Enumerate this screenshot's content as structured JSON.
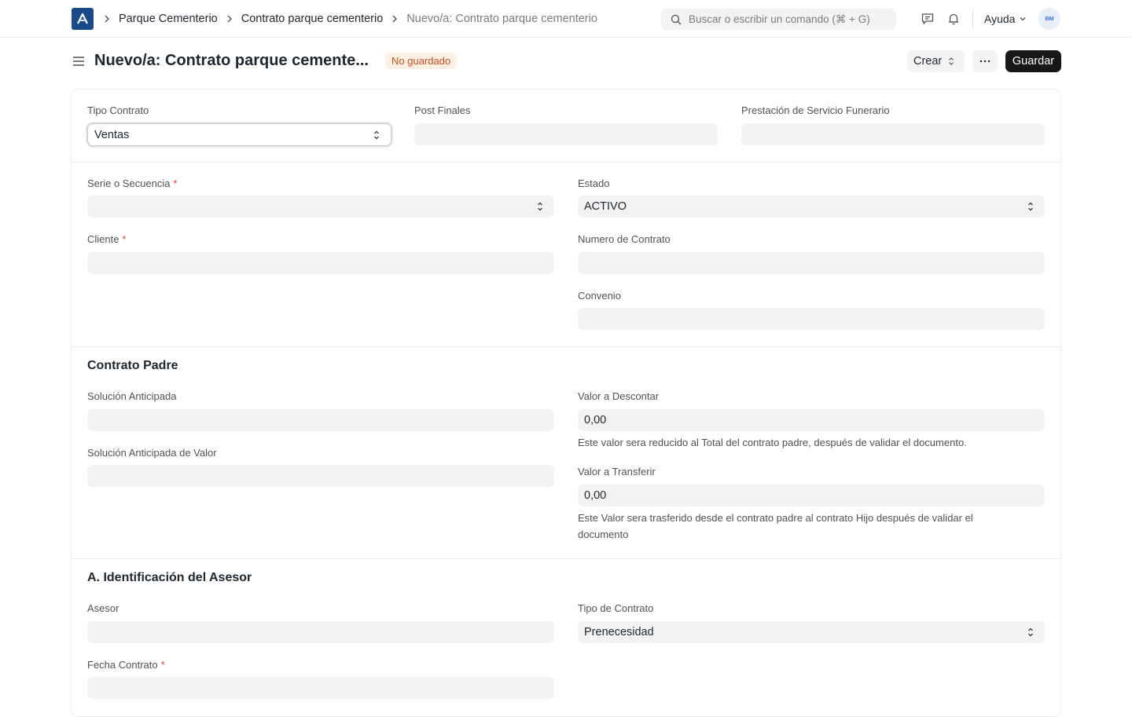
{
  "navbar": {
    "breadcrumbs": [
      "Parque Cementerio",
      "Contrato parque cementerio",
      "Nuevo/a: Contrato parque cementerio"
    ],
    "search_placeholder": "Buscar o escribir un comando (⌘ + G)",
    "help_label": "Ayuda",
    "avatar_initials": "BM"
  },
  "page": {
    "title": "Nuevo/a: Contrato parque cemente...",
    "status_badge": "No guardado",
    "create_label": "Crear",
    "more_label": "···",
    "save_label": "Guardar"
  },
  "form": {
    "tipo_contrato": {
      "label": "Tipo Contrato",
      "value": "Ventas"
    },
    "post_finales": {
      "label": "Post Finales",
      "value": ""
    },
    "prestacion": {
      "label": "Prestación de Servicio Funerario",
      "value": ""
    },
    "serie": {
      "label": "Serie o Secuencia",
      "required": "*",
      "value": ""
    },
    "estado": {
      "label": "Estado",
      "value": "ACTIVO"
    },
    "cliente": {
      "label": "Cliente",
      "required": "*",
      "value": ""
    },
    "numero_contrato": {
      "label": "Numero de Contrato",
      "value": ""
    },
    "convenio": {
      "label": "Convenio",
      "value": ""
    },
    "contrato_padre": {
      "title": "Contrato Padre",
      "solucion_anticipada": {
        "label": "Solución Anticipada",
        "value": ""
      },
      "solucion_anticipada_valor": {
        "label": "Solución Anticipada de Valor",
        "value": ""
      },
      "valor_descontar": {
        "label": "Valor a Descontar",
        "value": "0,00",
        "help": "Este valor sera reducido al Total del contrato padre, después de validar el documento."
      },
      "valor_transferir": {
        "label": "Valor a Transferir",
        "value": "0,00",
        "help_line1": "Este Valor sera trasferido desde el contrato padre al contrato Hijo después de validar el",
        "help_line2": "documento"
      }
    },
    "asesor_section": {
      "title": "A. Identificación del Asesor",
      "asesor": {
        "label": "Asesor",
        "value": ""
      },
      "tipo_de_contrato": {
        "label": "Tipo de Contrato",
        "value": "Prenecesidad"
      },
      "fecha_contrato": {
        "label": "Fecha Contrato",
        "required": "*",
        "value": ""
      }
    }
  },
  "colors": {
    "accent": "#1a4a8a",
    "badge_bg": "#fff0e6",
    "badge_text": "#c4521b",
    "primary_btn": "#171717"
  }
}
